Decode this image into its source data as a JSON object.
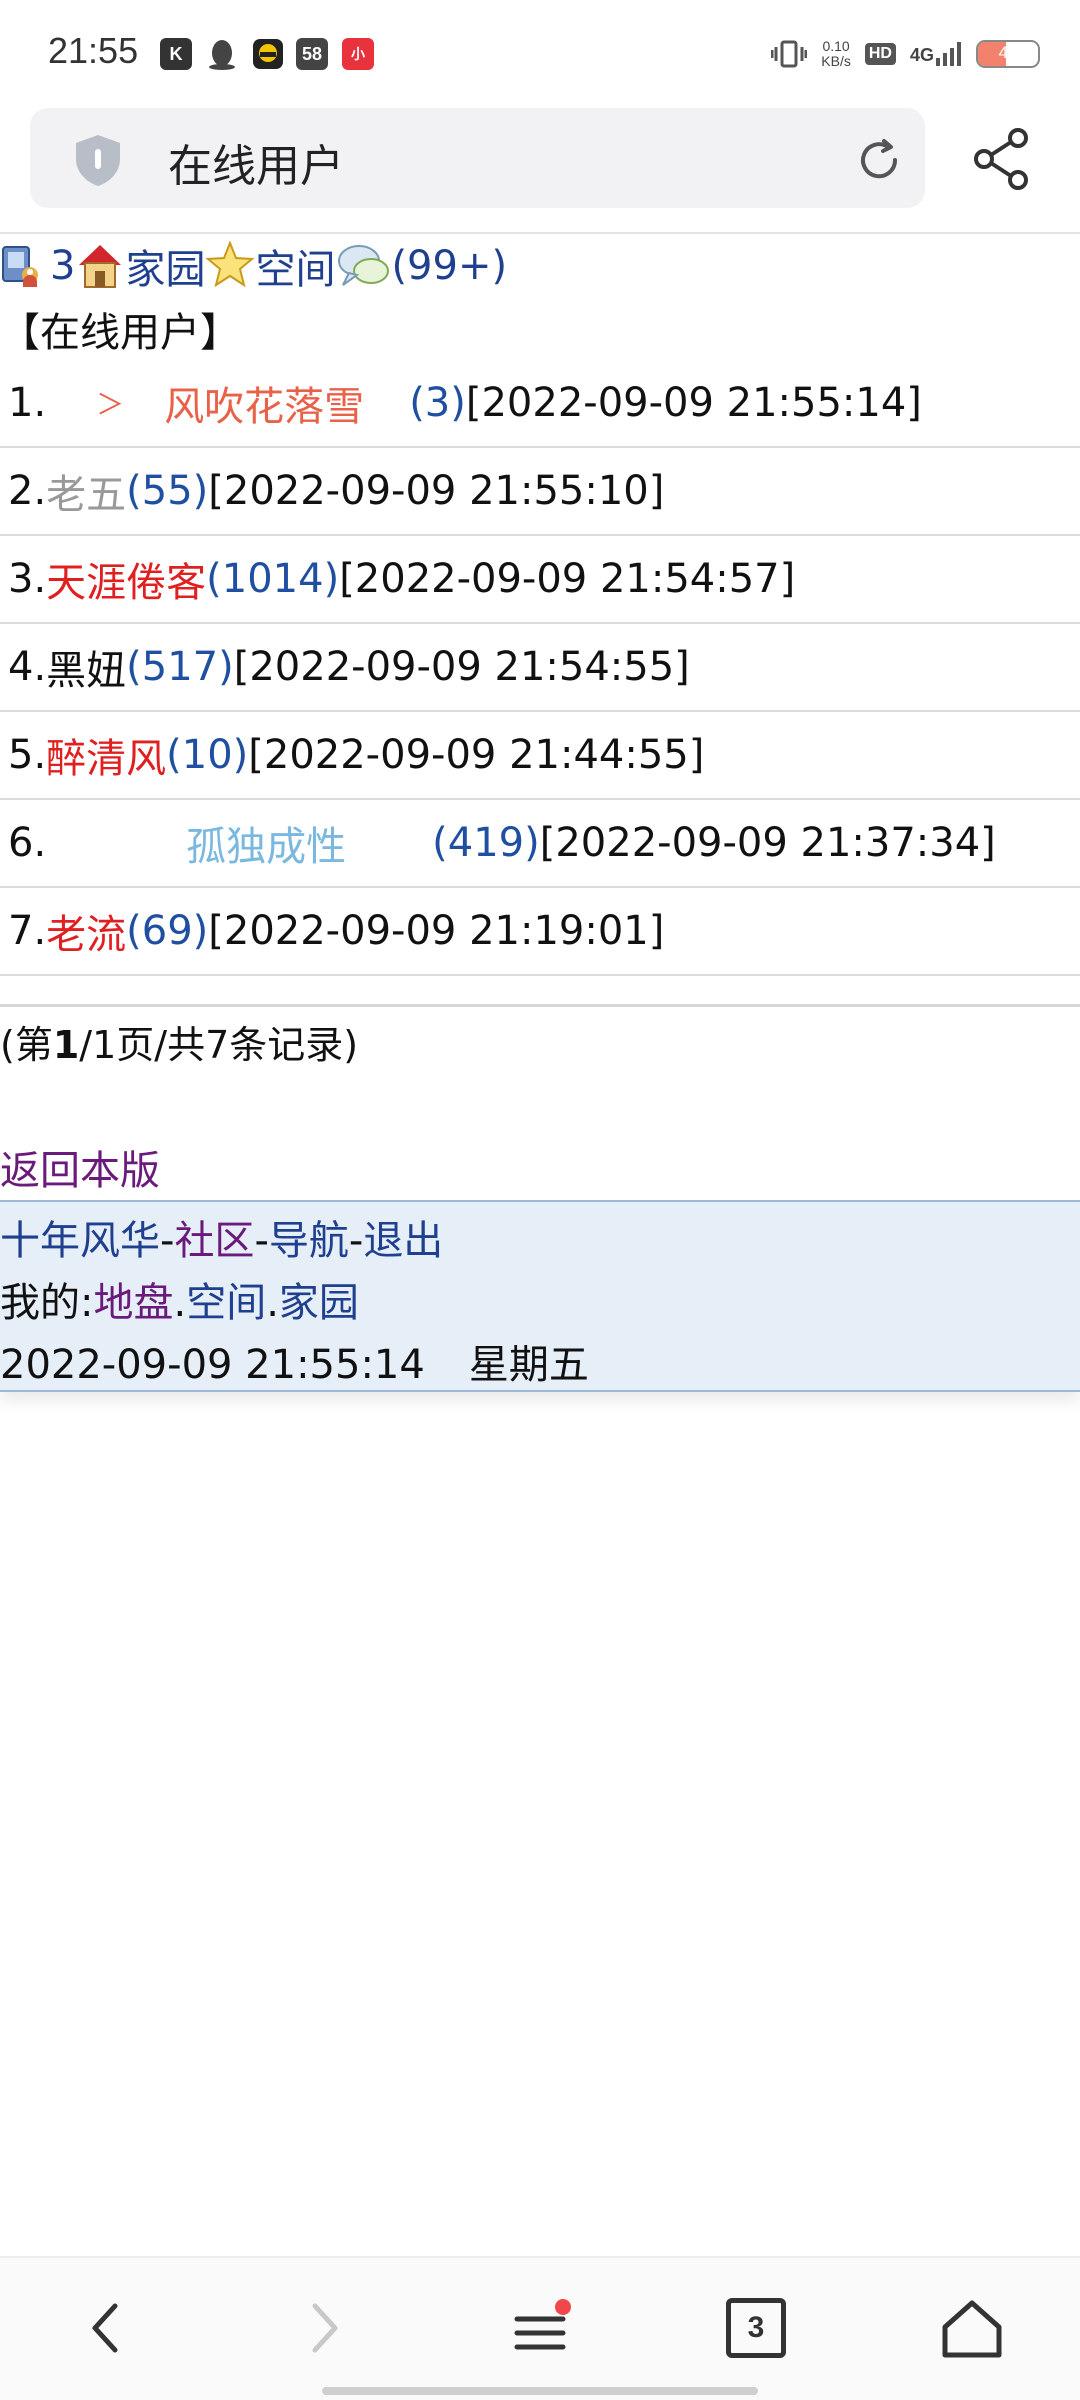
{
  "status_bar": {
    "time": "21:55",
    "apps": [
      {
        "name": "k-app-icon",
        "label": "K",
        "color": "#333333"
      },
      {
        "name": "qq-penguin-icon",
        "label": "",
        "color": "#444444"
      },
      {
        "name": "taxi-app-icon",
        "label": "",
        "color": "#f5c400"
      },
      {
        "name": "58-app-icon",
        "label": "58",
        "color": "#444444"
      },
      {
        "name": "red-app-icon",
        "label": "小",
        "color": "#e8323c"
      }
    ],
    "net_speed_value": "0.10",
    "net_speed_unit": "KB/s",
    "hd": "HD",
    "network": "4G",
    "battery": "46",
    "battery_level": 0.46
  },
  "address_bar": {
    "title": "在线用户"
  },
  "nav_row": {
    "online_count": "3",
    "home": "家园",
    "space": "空间",
    "messages": "(99+)"
  },
  "page_heading": "【在线用户】",
  "users": [
    {
      "num": "1.",
      "name": "风吹花落雪",
      "count": "(3)",
      "time": "[2022-09-09 21:55:14]",
      "color": "#e8624a",
      "prefix": "＞"
    },
    {
      "num": "2.",
      "name": "老五",
      "count": "(55)",
      "time": "[2022-09-09 21:55:10]",
      "color": "#999999",
      "prefix": ""
    },
    {
      "num": "3.",
      "name": "天涯倦客",
      "count": "(1014)",
      "time": "[2022-09-09 21:54:57]",
      "color": "#e02020",
      "prefix": ""
    },
    {
      "num": "4.",
      "name": "黑妞",
      "count": "(517)",
      "time": "[2022-09-09 21:54:55]",
      "color": "#111111",
      "prefix": ""
    },
    {
      "num": "5.",
      "name": "醉清风",
      "count": "(10)",
      "time": "[2022-09-09 21:44:55]",
      "color": "#e02020",
      "prefix": ""
    },
    {
      "num": "6.",
      "name": "孤独成性",
      "count": "(419)",
      "time": "[2022-09-09 21:37:34]",
      "color": "#7ab8e0",
      "prefix": ""
    },
    {
      "num": "7.",
      "name": "老流",
      "count": "(69)",
      "time": "[2022-09-09 21:19:01]",
      "color": "#e02020",
      "prefix": ""
    }
  ],
  "pager": {
    "open": "(第",
    "current": "1",
    "rest": "/1页/共7条记录)"
  },
  "back_link": "返回本版",
  "footer": {
    "site": "十年风华",
    "community": "社区",
    "nav": "导航",
    "logout": "退出",
    "sep": "-",
    "mine_label": "我的:",
    "territory": "地盘",
    "space": "空间",
    "home": "家园",
    "dot": ".",
    "datetime": "2022-09-09 21:55:14",
    "weekday": "星期五"
  },
  "bottom_nav": {
    "tab_count": "3"
  }
}
